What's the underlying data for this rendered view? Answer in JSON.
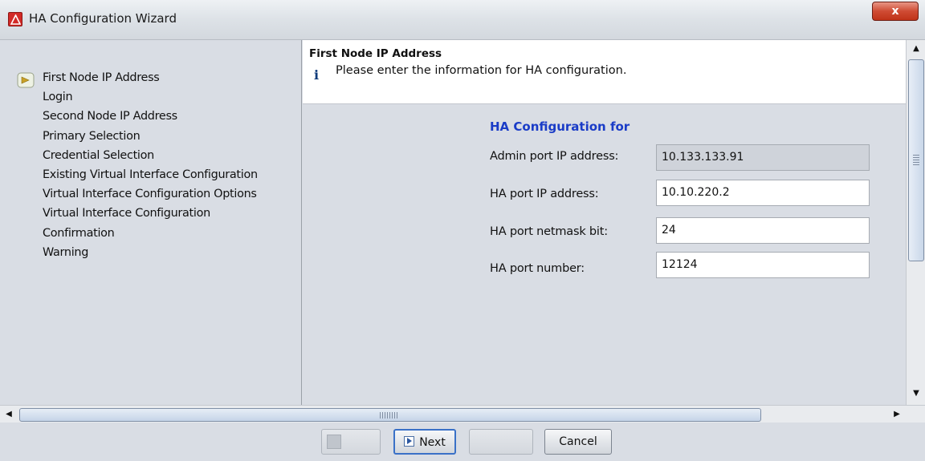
{
  "window": {
    "title": "HA Configuration Wizard",
    "close_label": "x"
  },
  "steps": {
    "current_index": 0,
    "items": [
      "First Node IP Address",
      "Login",
      "Second Node IP Address",
      "Primary Selection",
      "Credential Selection",
      "Existing Virtual Interface Configuration",
      "Virtual Interface Configuration Options",
      "Virtual Interface Configuration",
      "Confirmation",
      "Warning"
    ]
  },
  "header": {
    "title": "First Node IP Address",
    "info_icon": "i",
    "description": "Please enter the information for HA configuration."
  },
  "form": {
    "title": "HA Configuration for",
    "fields": [
      {
        "label": "Admin port IP address:",
        "value": "10.133.133.91",
        "readonly": true
      },
      {
        "label": "HA port IP address:",
        "value": "10.10.220.2",
        "readonly": false
      },
      {
        "label": "HA port netmask bit:",
        "value": "24",
        "readonly": false
      },
      {
        "label": "HA port number:",
        "value": "12124",
        "readonly": false
      }
    ]
  },
  "buttons": {
    "back_label": "",
    "next_label": "Next",
    "finish_label": "",
    "cancel_label": "Cancel"
  },
  "icons": {
    "app": "warning-triangle-icon",
    "step_current": "current-step-arrow-icon",
    "info": "info-icon",
    "next": "play-arrow-icon"
  },
  "colors": {
    "form_title": "#1a3cc7",
    "close_button": "#c9412a",
    "app_icon": "#d22a27"
  }
}
